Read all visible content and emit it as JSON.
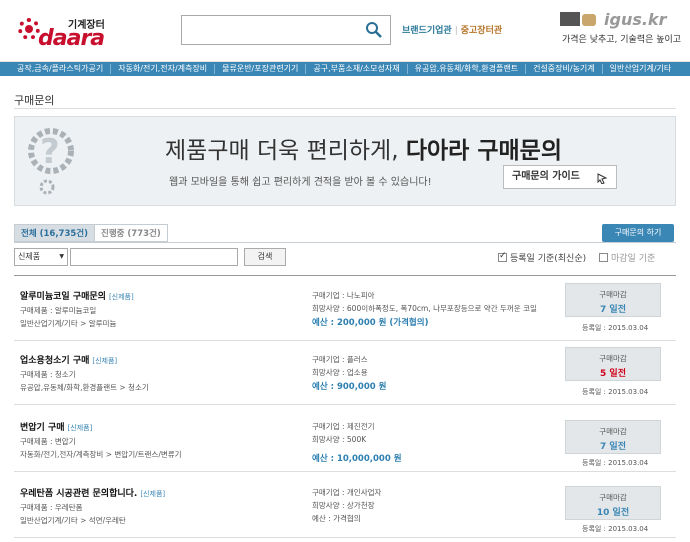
{
  "header": {
    "logo_sub": "기계장터",
    "logo_main": "daara",
    "search": {
      "value": "",
      "placeholder": ""
    },
    "links": [
      "브랜드기업관",
      "중고장터관"
    ],
    "ad": {
      "brand": "igus.kr",
      "slogan": "가격은 낮추고, 기술력은 높이고"
    }
  },
  "categories": [
    "공작,금속/플라스틱가공기",
    "자동화/전기,전자/계측장비",
    "물류운반/포장관련기기",
    "공구,부품소재/소모성자재",
    "유공압,유동체/화학,환경플랜트",
    "건설중장비/농기계",
    "일반산업기계/기타"
  ],
  "page_title": "구매문의",
  "banner": {
    "headline_a": "제품구매 더욱 편리하게, ",
    "headline_b": "다아라 구매문의",
    "sub": "웹과 모바일을 통해 쉽고 편리하게  견적을 받아 볼 수 있습니다!",
    "guide_button": "구매문의 가이드"
  },
  "tabs": [
    {
      "label": "전체 (16,735건)",
      "active": true
    },
    {
      "label": "진행중 (773건)",
      "active": false
    }
  ],
  "request_button": "구매문의 하기",
  "filter": {
    "select_value": "신제품",
    "keyword": "",
    "search_button": "검색"
  },
  "sort": {
    "option1": "등록일 기준(최신순)",
    "option1_checked": true,
    "option2": "마감일 기준",
    "option2_checked": false
  },
  "items": [
    {
      "title": "알루미늄코일 구매문의",
      "tag": "[신제품]",
      "product": "구매제품 : 알루미늄코일",
      "category": "일반산업기계/기타 > 알루미늄",
      "company": "구매기업 : 나노피아",
      "spec": "희망사양 : 600이하폭정도, 폭70cm, 나무포장등으로 약간 두꺼운 코일",
      "budget": "예산 : 200,000 원 (가격협의)",
      "deadline_label": "구매마감",
      "deadline_value": "7 일전",
      "deadline_urgent": false,
      "registered": "등록일 : 2015.03.04"
    },
    {
      "title": "업소용청소기 구매",
      "tag": "[신제품]",
      "product": "구매제품 : 청소기",
      "category": "유공압,유동체/화학,환경플랜트 > 청소기",
      "company": "구매기업 : 플러스",
      "spec": "희망사양 : 업소용",
      "budget": "예산 : 900,000 원",
      "deadline_label": "구매마감",
      "deadline_value": "5 일전",
      "deadline_urgent": true,
      "registered": "등록일 : 2015.03.04"
    },
    {
      "title": "변압기 구매",
      "tag": "[신제품]",
      "product": "구매제품 : 변압기",
      "category": "자동화/전기,전자/계측장비 > 변압기/트랜스/변류기",
      "company": "구매기업 : 제진전기",
      "spec": "희망사양 : 500K",
      "budget": "예산 : 10,000,000 원",
      "deadline_label": "구매마감",
      "deadline_value": "7 일전",
      "deadline_urgent": false,
      "registered": "등록일 : 2015.03.04"
    },
    {
      "title": "우레탄폼 시공관련 문의합니다.",
      "tag": "[신제품]",
      "product": "구매제품 : 우레탄폼",
      "category": "일반산업기계/기타 > 석면/우레탄",
      "company": "구매기업 : 개인사업자",
      "spec": "희망사양 : 상가천장",
      "budget": "예산 : 가격협의",
      "deadline_label": "구매마감",
      "deadline_value": "10 일전",
      "deadline_urgent": false,
      "registered": "등록일 : 2015.03.04"
    }
  ]
}
